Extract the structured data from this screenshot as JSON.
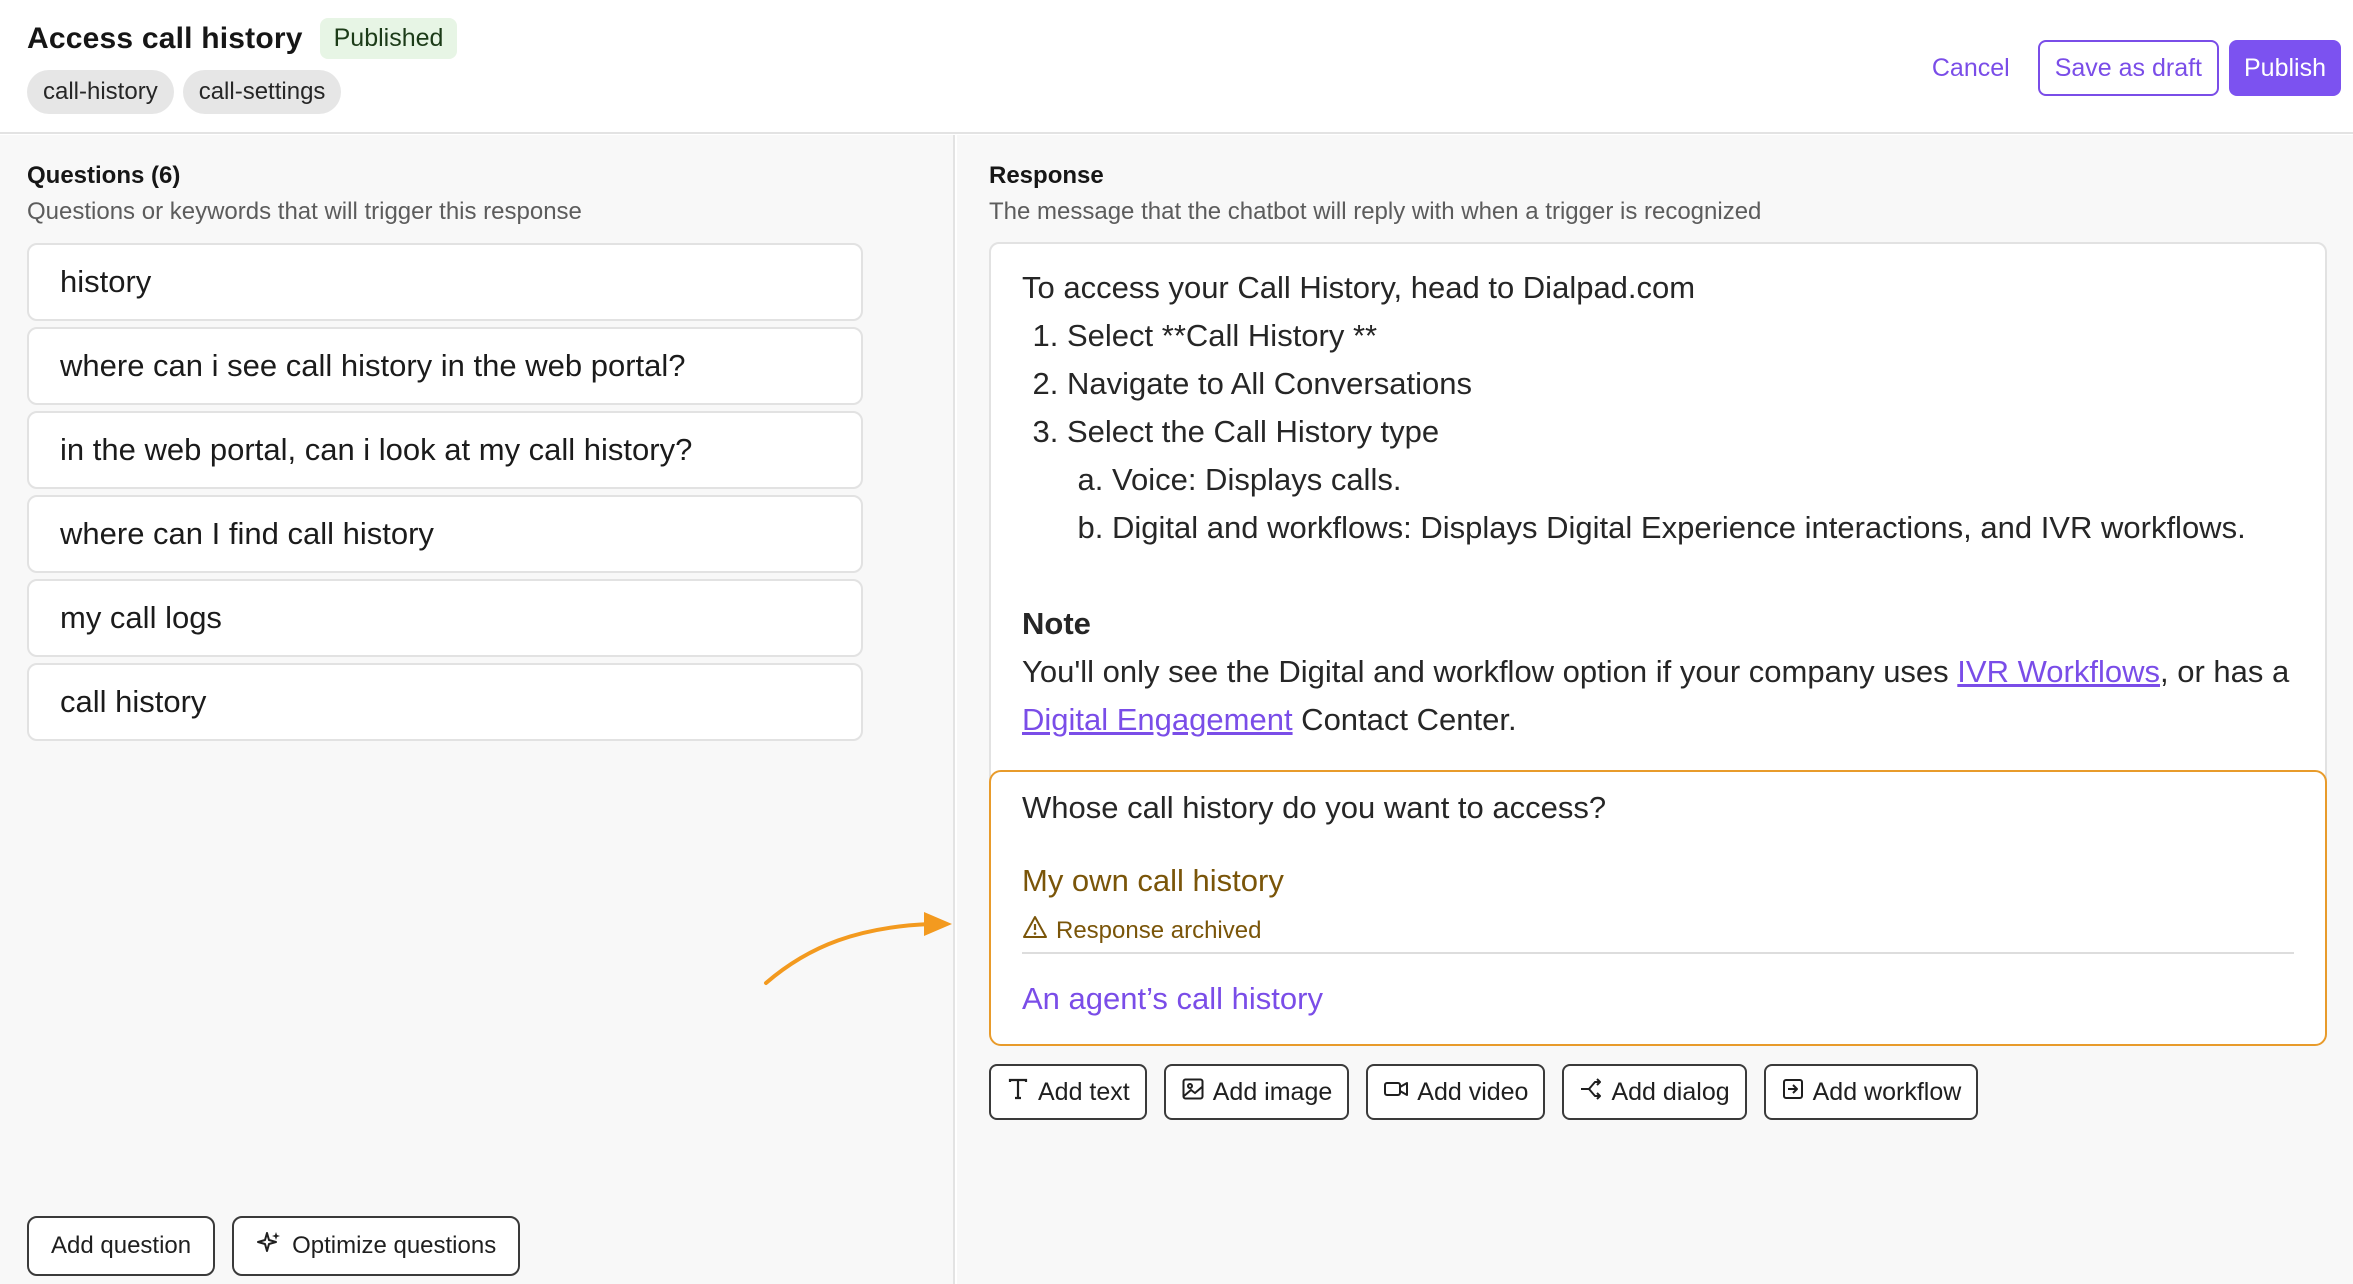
{
  "header": {
    "title": "Access call history",
    "status_badge": "Published",
    "tags": [
      "call-history",
      "call-settings"
    ],
    "cancel_label": "Cancel",
    "save_draft_label": "Save as draft",
    "publish_label": "Publish"
  },
  "questions": {
    "title": "Questions (6)",
    "subtitle": "Questions or keywords that will trigger this response",
    "items": [
      "history",
      "where can i see call history in the web portal?",
      "in the web portal, can i look at my call history?",
      "where can I find call history",
      "my call logs",
      "call history"
    ],
    "add_question_label": "Add question",
    "optimize_label": "Optimize questions"
  },
  "response": {
    "title": "Response",
    "subtitle": "The message that the chatbot will reply with when a trigger is recognized",
    "intro": "To access your Call History, head to Dialpad.com",
    "steps": [
      "Select **Call History **",
      "Navigate to All Conversations",
      "Select the Call History type"
    ],
    "substeps": [
      "Voice: Displays calls.",
      "Digital and workflows: Displays Digital Experience interactions, and IVR workflows."
    ],
    "note_title": "Note",
    "note_text_1": "You'll only see the Digital and workflow option if your company uses ",
    "note_link_1": "IVR Workflows",
    "note_text_2": ", or has a ",
    "note_link_2": "Digital Engagement",
    "note_text_3": " Contact Center."
  },
  "dialog": {
    "question": "Whose call history do you want to access?",
    "option_1": "My own call history",
    "archived_label": "Response archived",
    "option_2": "An agent’s call history"
  },
  "add_buttons": {
    "text": "Add text",
    "image": "Add image",
    "video": "Add video",
    "dialog": "Add dialog",
    "workflow": "Add workflow"
  },
  "colors": {
    "accent": "#7c52f0",
    "warning_border": "#e89b2b",
    "archived_text": "#7a5509",
    "arrow": "#f39a1f"
  }
}
